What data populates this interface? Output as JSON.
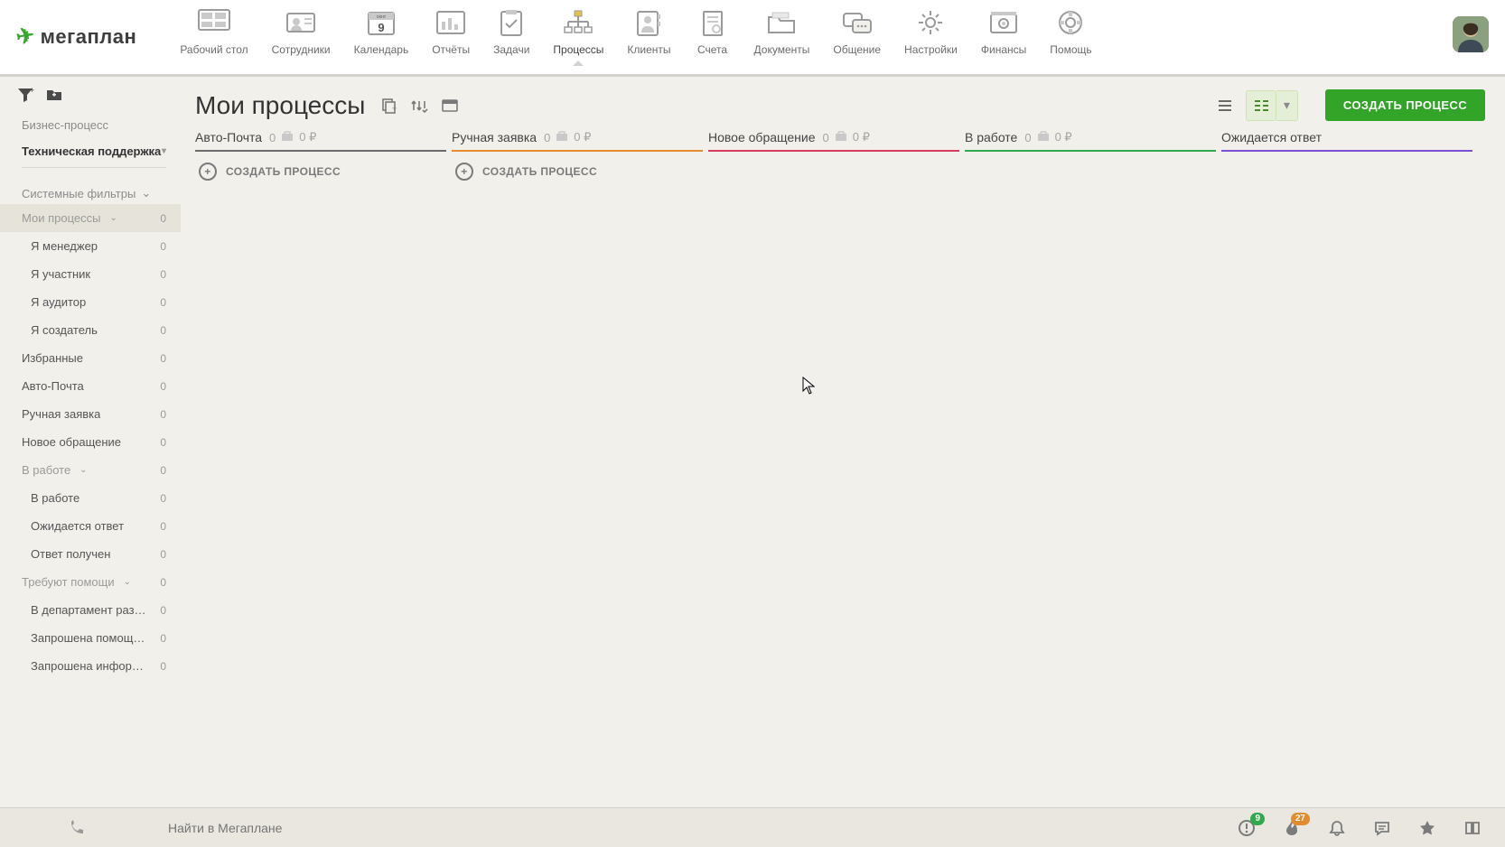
{
  "brand": "мегаплан",
  "calendar_badge": {
    "month": "сент",
    "day": "9"
  },
  "nav": [
    {
      "label": "Рабочий стол"
    },
    {
      "label": "Сотрудники"
    },
    {
      "label": "Календарь"
    },
    {
      "label": "Отчёты"
    },
    {
      "label": "Задачи"
    },
    {
      "label": "Процессы"
    },
    {
      "label": "Клиенты"
    },
    {
      "label": "Счета"
    },
    {
      "label": "Документы"
    },
    {
      "label": "Общение"
    },
    {
      "label": "Настройки"
    },
    {
      "label": "Финансы"
    },
    {
      "label": "Помощь"
    }
  ],
  "sidebar": {
    "category": "Бизнес-процесс",
    "process": "Техническая поддержка",
    "filters_header": "Системные фильтры",
    "items": [
      {
        "label": "Мои процессы",
        "count": "0",
        "active": true,
        "expandable": true,
        "muted": true
      },
      {
        "label": "Я менеджер",
        "count": "0",
        "sub": true
      },
      {
        "label": "Я участник",
        "count": "0",
        "sub": true
      },
      {
        "label": "Я аудитор",
        "count": "0",
        "sub": true
      },
      {
        "label": "Я создатель",
        "count": "0",
        "sub": true
      },
      {
        "label": "Избранные",
        "count": "0"
      },
      {
        "label": "Авто-Почта",
        "count": "0"
      },
      {
        "label": "Ручная заявка",
        "count": "0"
      },
      {
        "label": "Новое обращение",
        "count": "0"
      },
      {
        "label": "В работе",
        "count": "0",
        "expandable": true,
        "muted": true
      },
      {
        "label": "В работе",
        "count": "0",
        "sub": true
      },
      {
        "label": "Ожидается ответ",
        "count": "0",
        "sub": true
      },
      {
        "label": "Ответ получен",
        "count": "0",
        "sub": true
      },
      {
        "label": "Требуют помощи",
        "count": "0",
        "expandable": true,
        "muted": true
      },
      {
        "label": "В департамент разр...",
        "count": "0",
        "sub": true
      },
      {
        "label": "Запрошена помощь ...",
        "count": "0",
        "sub": true
      },
      {
        "label": "Запрошена информа...",
        "count": "0",
        "sub": true
      }
    ]
  },
  "page_title": "Мои процессы",
  "create_label": "СОЗДАТЬ ПРОЦЕСС",
  "columns": [
    {
      "title": "Авто-Почта",
      "count": "0",
      "price": "0 ₽",
      "add": "СОЗДАТЬ ПРОЦЕСС"
    },
    {
      "title": "Ручная заявка",
      "count": "0",
      "price": "0 ₽",
      "add": "СОЗДАТЬ ПРОЦЕСС"
    },
    {
      "title": "Новое обращение",
      "count": "0",
      "price": "0 ₽"
    },
    {
      "title": "В работе",
      "count": "0",
      "price": "0 ₽"
    },
    {
      "title": "Ожидается ответ"
    }
  ],
  "footer": {
    "search_placeholder": "Найти в Мегаплане",
    "badge1": "9",
    "badge2": "27"
  }
}
